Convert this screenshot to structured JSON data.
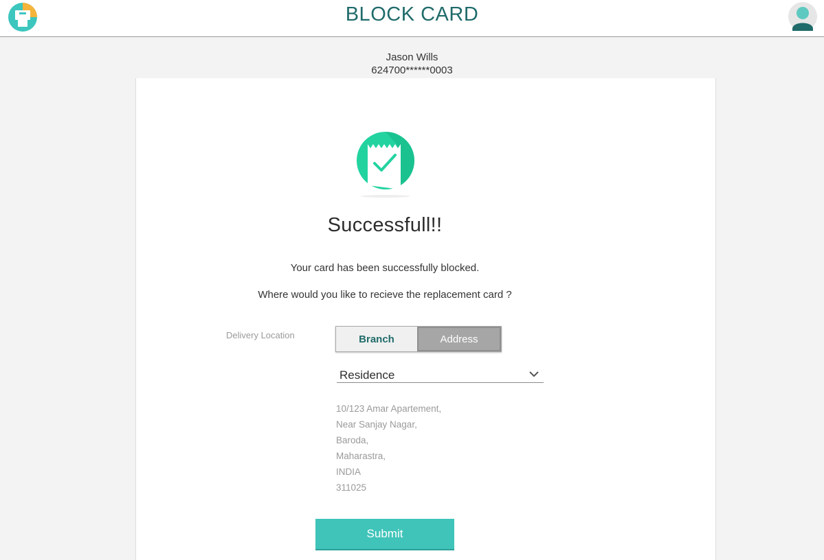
{
  "header": {
    "title": "BLOCK CARD",
    "logo_icon": "printer-logo-icon",
    "profile_icon": "user-avatar-icon"
  },
  "account": {
    "name": "Jason Wills",
    "card_number": "624700******0003"
  },
  "result": {
    "icon": "receipt-check-icon",
    "title": "Successfull!!",
    "message": "Your card has been successfully blocked.",
    "question": "Where would you like to recieve the replacement card ?"
  },
  "delivery": {
    "label": "Delivery Location",
    "options": [
      "Branch",
      "Address"
    ],
    "selected_option": "Address",
    "address_type": "Residence",
    "address_lines": [
      "10/123 Amar Apartement,",
      "Near Sanjay Nagar,",
      "Baroda,",
      "Maharastra,",
      "INDIA",
      "311025"
    ]
  },
  "actions": {
    "submit_label": "Submit"
  },
  "colors": {
    "accent": "#40c4b9",
    "title": "#1f6b6a",
    "success_green": "#22d3a0"
  }
}
